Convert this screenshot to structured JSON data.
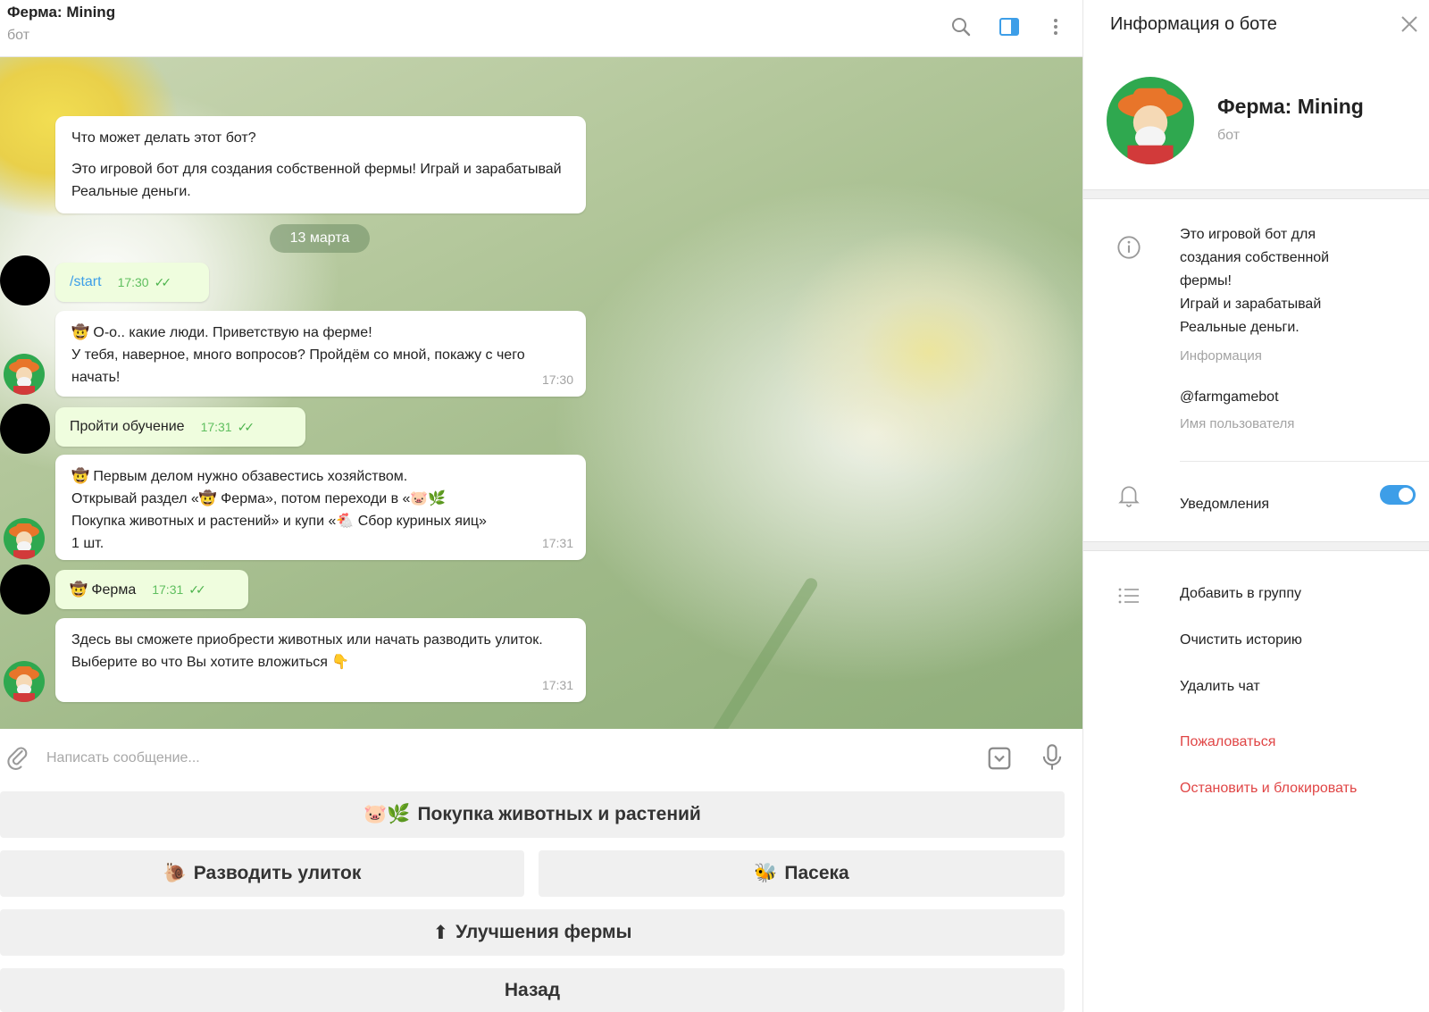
{
  "chat": {
    "title": "Ферма: Mining",
    "subtitle": "бот",
    "date_divider": "13 марта",
    "intro": {
      "heading": "Что может делать этот бот?",
      "text": "Это игровой бот для создания собственной фермы! Играй и зарабатывай Реальные деньги."
    },
    "messages": [
      {
        "dir": "out",
        "text": "/start",
        "time": "17:30"
      },
      {
        "dir": "in",
        "lines": [
          "🤠 О-о.. какие люди. Приветствую на ферме!",
          "У тебя, наверное, много вопросов? Пройдём со мной, покажу с чего начать!"
        ],
        "time": "17:30"
      },
      {
        "dir": "out",
        "text": "Пройти обучение",
        "time": "17:31"
      },
      {
        "dir": "in",
        "lines": [
          "🤠 Первым делом нужно обзавестись хозяйством.",
          "Открывай раздел «🤠 Ферма», потом переходи в «🐷🌿",
          "Покупка животных и растений» и купи «🐔 Сбор куриных яиц»",
          "1 шт."
        ],
        "time": "17:31"
      },
      {
        "dir": "out",
        "text": "🤠 Ферма",
        "time": "17:31"
      },
      {
        "dir": "in",
        "lines": [
          "Здесь вы сможете приобрести животных или начать разводить улиток.",
          "Выберите во что Вы хотите вложиться 👇"
        ],
        "time": "17:31"
      }
    ]
  },
  "composer": {
    "placeholder": "Написать сообщение..."
  },
  "keyboard": {
    "buy": {
      "icon": "🐷🌿",
      "label": "Покупка животных и растений"
    },
    "snails": {
      "icon": "🐌",
      "label": "Разводить улиток"
    },
    "apiary": {
      "icon": "🐝",
      "label": "Пасека"
    },
    "upgrades": {
      "icon": "⬆",
      "label": "Улучшения фермы"
    },
    "back": {
      "label": "Назад"
    }
  },
  "info_panel": {
    "title": "Информация о боте",
    "bot_name": "Ферма: Mining",
    "bot_type": "бот",
    "description": "Это игровой бот для создания собственной фермы!\nИграй и зарабатывай Реальные деньги.",
    "description_caption": "Информация",
    "username": "@farmgamebot",
    "username_caption": "Имя пользователя",
    "notifications_label": "Уведомления",
    "notifications_on": true,
    "actions": [
      "Добавить в группу",
      "Очистить историю",
      "Удалить чат"
    ],
    "danger_actions": [
      "Пожаловаться",
      "Остановить и блокировать"
    ]
  },
  "colors": {
    "accent": "#3d9ee8",
    "outgoing_bubble": "#effdde",
    "danger": "#e04545",
    "bot_avatar_bg": "#2fa84f"
  },
  "icons": [
    "search-icon",
    "sidebar-toggle-icon",
    "more-vertical-icon",
    "close-icon",
    "info-icon",
    "bell-icon",
    "list-icon",
    "attach-icon",
    "bot-keyboard-icon",
    "mic-icon",
    "double-check-icon"
  ]
}
